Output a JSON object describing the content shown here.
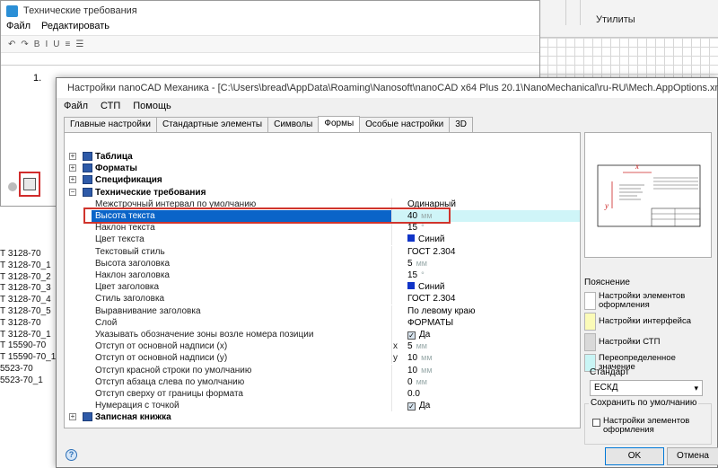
{
  "background": {
    "ribbon_label": "Утилиты",
    "list_items": [
      "Т 3128-70",
      "Т 3128-70_1",
      "Т 3128-70_2",
      "Т 3128-70_3",
      "Т 3128-70_4",
      "Т 3128-70_5",
      "Т 3128-70",
      "Т 3128-70_1",
      "Т 15590-70",
      "Т 15590-70_1",
      "5523-70",
      "5523-70_1"
    ]
  },
  "tech_window": {
    "title": "Технические требования",
    "menu": [
      "Файл",
      "Редактировать"
    ],
    "list_number": "1."
  },
  "dialog": {
    "title": "Настройки nanoCAD Механика - [C:\\Users\\bread\\AppData\\Roaming\\Nanosoft\\nanoCAD x64 Plus 20.1\\NanoMechanical\\ru-RU\\Mech.AppOptions.xml]",
    "menu": [
      "Файл",
      "СТП",
      "Помощь"
    ],
    "tabs": [
      "Главные настройки",
      "Стандартные элементы",
      "Символы",
      "Формы",
      "Особые настройки",
      "3D"
    ],
    "active_tab": "Формы",
    "groups_top": [
      {
        "label": "Таблица",
        "expander": "+"
      },
      {
        "label": "Форматы",
        "expander": "+"
      },
      {
        "label": "Спецификация",
        "expander": "+"
      },
      {
        "label": "Технические требования",
        "expander": "−"
      }
    ],
    "properties": [
      {
        "label": "Межстрочный интервал по умолчанию",
        "value": "Одинарный",
        "unit": ""
      },
      {
        "label": "Высота текста",
        "value": "40",
        "unit": "мм",
        "selected": true
      },
      {
        "label": "Наклон текста",
        "value": "15",
        "unit": "°"
      },
      {
        "label": "Цвет текста",
        "value": "Синий",
        "unit": "",
        "swatch": "#1034c8"
      },
      {
        "label": "Текстовый стиль",
        "value": "ГОСТ 2.304",
        "unit": ""
      },
      {
        "label": "Высота заголовка",
        "value": "5",
        "unit": "мм"
      },
      {
        "label": "Наклон заголовка",
        "value": "15",
        "unit": "°"
      },
      {
        "label": "Цвет заголовка",
        "value": "Синий",
        "unit": "",
        "swatch": "#1034c8"
      },
      {
        "label": "Стиль заголовка",
        "value": "ГОСТ 2.304",
        "unit": ""
      },
      {
        "label": "Выравнивание заголовка",
        "value": "По левому краю",
        "unit": ""
      },
      {
        "label": "Слой",
        "value": "ФОРМАТЫ",
        "unit": ""
      },
      {
        "label": "Указывать обозначение зоны возле номера позиции",
        "value": "Да",
        "unit": "",
        "checkbox": true
      },
      {
        "label": "Отступ от основной надписи (x)",
        "coord": "x",
        "value": "5",
        "unit": "мм"
      },
      {
        "label": "Отступ от основной надписи (y)",
        "coord": "y",
        "value": "10",
        "unit": "мм"
      },
      {
        "label": "Отступ красной строки по умолчанию",
        "value": "10",
        "unit": "мм"
      },
      {
        "label": "Отступ абзаца слева по умолчанию",
        "value": "0",
        "unit": "мм"
      },
      {
        "label": "Отступ сверху от границы формата",
        "value": "0.0",
        "unit": ""
      },
      {
        "label": "Нумерация с точкой",
        "value": "Да",
        "unit": "",
        "checkbox": true
      }
    ],
    "groups_bottom": [
      {
        "label": "Записная книжка",
        "expander": "+"
      }
    ],
    "preview_labels": {
      "x": "x",
      "y": "y"
    },
    "legend": {
      "title": "Пояснение",
      "items": [
        {
          "label": "Настройки элементов оформления",
          "color": "#ffffff"
        },
        {
          "label": "Настройки интерфейса",
          "color": "#fbfbb8"
        },
        {
          "label": "Настройки СТП",
          "color": "#d9d9d9"
        },
        {
          "label": "Переопределенное значение",
          "color": "#c9f5f5"
        }
      ]
    },
    "standard": {
      "label": "Стандарт",
      "value": "ЕСКД"
    },
    "defaults": {
      "title": "Сохранить по умолчанию",
      "checkbox_label": "Настройки элементов оформления"
    },
    "buttons": {
      "ok": "OK",
      "cancel": "Отмена",
      "help": "?"
    }
  }
}
